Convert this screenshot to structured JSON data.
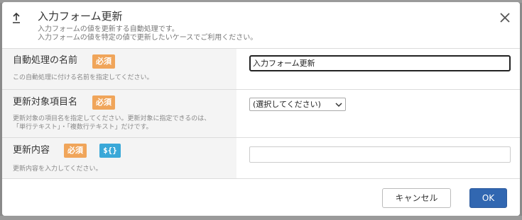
{
  "dialog": {
    "title": "入力フォーム更新",
    "description_line1": "入力フォームの値を更新する自動処理です。",
    "description_line2": "入力フォームの値を特定の値で更新したいケースでご利用ください。",
    "header_icon": "upload-icon",
    "close_icon": "close-icon"
  },
  "fields": {
    "name": {
      "label": "自動処理の名前",
      "required_badge": "必須",
      "help": "この自動処理に付ける名前を指定してください。",
      "value": "入力フォーム更新"
    },
    "target": {
      "label": "更新対象項目名",
      "required_badge": "必須",
      "help_line1": "更新対象の項目名を指定してください。更新対象に指定できるのは、",
      "help_line2": "「単行テキスト」・「複数行テキスト」だけです。",
      "selected": "(選択してください)"
    },
    "content": {
      "label": "更新内容",
      "required_badge": "必須",
      "variable_badge": "${}",
      "help": "更新内容を入力してください。",
      "value": ""
    }
  },
  "footer": {
    "cancel_label": "キャンセル",
    "ok_label": "OK"
  },
  "colors": {
    "required_badge": "#f0a55a",
    "variable_badge": "#3aa8d8",
    "primary_button": "#3167b1",
    "label_column_bg": "#f4f4f4"
  }
}
